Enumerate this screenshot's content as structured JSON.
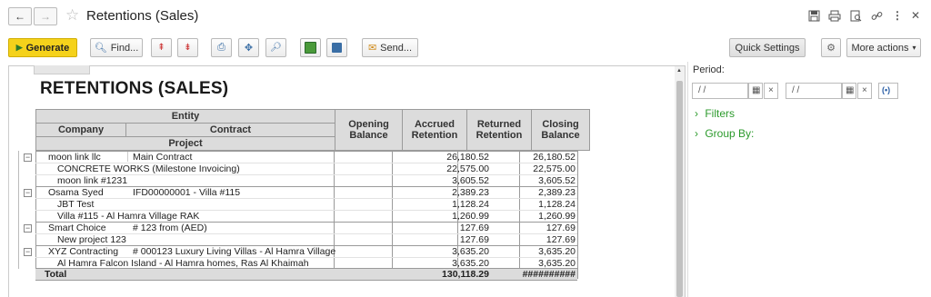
{
  "window": {
    "title": "Retentions (Sales)"
  },
  "nav": {
    "back_icon": "←",
    "forward_icon": "→",
    "star_icon": "☆"
  },
  "title_icons": [
    "save-icon",
    "print-icon",
    "preview-icon",
    "link-icon",
    "more-icon",
    "close-icon"
  ],
  "toolbar": {
    "generate_label": "Generate",
    "find_label": "Find...",
    "send_label": "Send...",
    "quick_settings_label": "Quick Settings",
    "more_actions_label": "More actions"
  },
  "report": {
    "title": "RETENTIONS (SALES)",
    "headers": {
      "entity": "Entity",
      "company": "Company",
      "contract": "Contract",
      "project": "Project",
      "opening_balance": "Opening Balance",
      "accrued_retention": "Accrued Retention",
      "returned_retention": "Returned Retention",
      "closing_balance": "Closing Balance"
    },
    "rows": [
      {
        "company": "moon link llc",
        "contract": "Main Contract",
        "opening": "",
        "accrued": "26,180.52",
        "returned": "",
        "closing": "26,180.52"
      },
      {
        "project": "CONCRETE WORKS (Milestone Invoicing)",
        "opening": "",
        "accrued": "22,575.00",
        "returned": "",
        "closing": "22,575.00"
      },
      {
        "project": "moon link #1231",
        "opening": "",
        "accrued": "3,605.52",
        "returned": "",
        "closing": "3,605.52"
      },
      {
        "company": "Osama Syed",
        "contract": "IFD00000001 - Villa #115",
        "opening": "",
        "accrued": "2,389.23",
        "returned": "",
        "closing": "2,389.23"
      },
      {
        "project": "JBT Test",
        "opening": "",
        "accrued": "1,128.24",
        "returned": "",
        "closing": "1,128.24"
      },
      {
        "project": "Villa #115 - Al Hamra Village RAK",
        "opening": "",
        "accrued": "1,260.99",
        "returned": "",
        "closing": "1,260.99"
      },
      {
        "company": "Smart Choice",
        "contract": "# 123 from (AED)",
        "opening": "",
        "accrued": "127.69",
        "returned": "",
        "closing": "127.69"
      },
      {
        "project": "New project 123",
        "opening": "",
        "accrued": "127.69",
        "returned": "",
        "closing": "127.69"
      },
      {
        "company": "XYZ Contracting",
        "contract": "# 000123 Luxury Living Villas - Al Hamra Village",
        "opening": "",
        "accrued": "3,635.20",
        "returned": "",
        "closing": "3,635.20"
      },
      {
        "project": "Al Hamra Falcon Island - Al Hamra homes, Ras Al Khaimah",
        "opening": "",
        "accrued": "3,635.20",
        "returned": "",
        "closing": "3,635.20"
      }
    ],
    "total": {
      "label": "Total",
      "accrued": "130,118.29",
      "closing": "##########"
    }
  },
  "panel": {
    "period_label": "Period:",
    "date_placeholder_from": "/ /",
    "date_placeholder_to": "/ /",
    "filters_label": "Filters",
    "group_by_label": "Group By:"
  }
}
